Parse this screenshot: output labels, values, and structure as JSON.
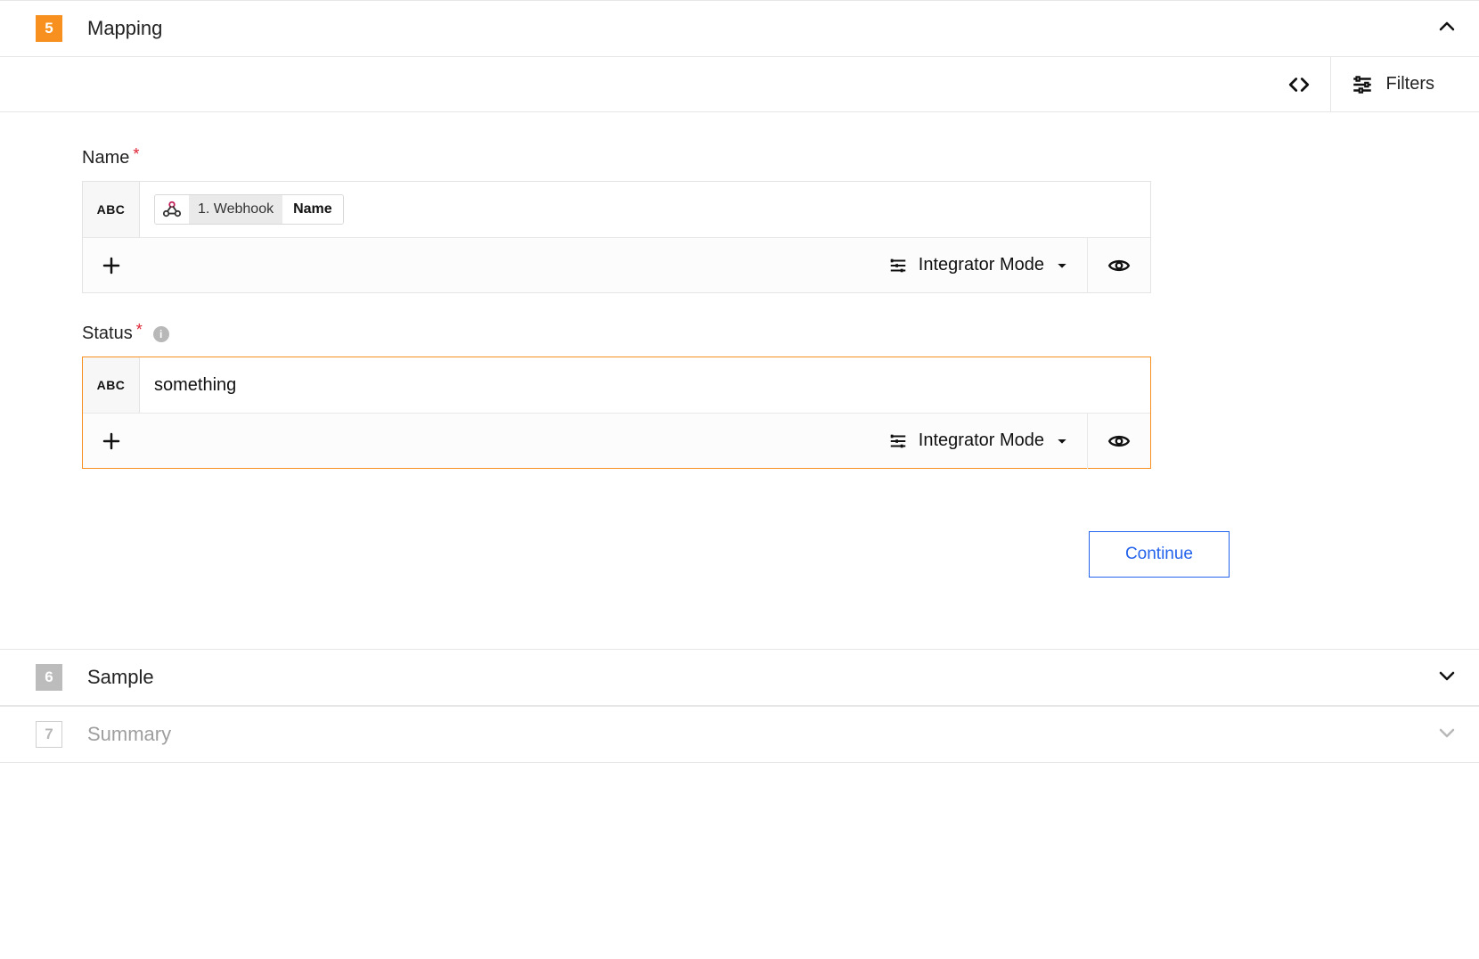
{
  "sections": {
    "mapping": {
      "num": "5",
      "title": "Mapping"
    },
    "sample": {
      "num": "6",
      "title": "Sample"
    },
    "summary": {
      "num": "7",
      "title": "Summary"
    }
  },
  "toolbar": {
    "filters_label": "Filters"
  },
  "fields": {
    "name": {
      "label": "Name",
      "type_label": "ABC",
      "pill_source": "1. Webhook",
      "pill_key": "Name",
      "mode_label": "Integrator Mode"
    },
    "status": {
      "label": "Status",
      "type_label": "ABC",
      "value": "something",
      "mode_label": "Integrator Mode"
    }
  },
  "actions": {
    "continue": "Continue"
  }
}
